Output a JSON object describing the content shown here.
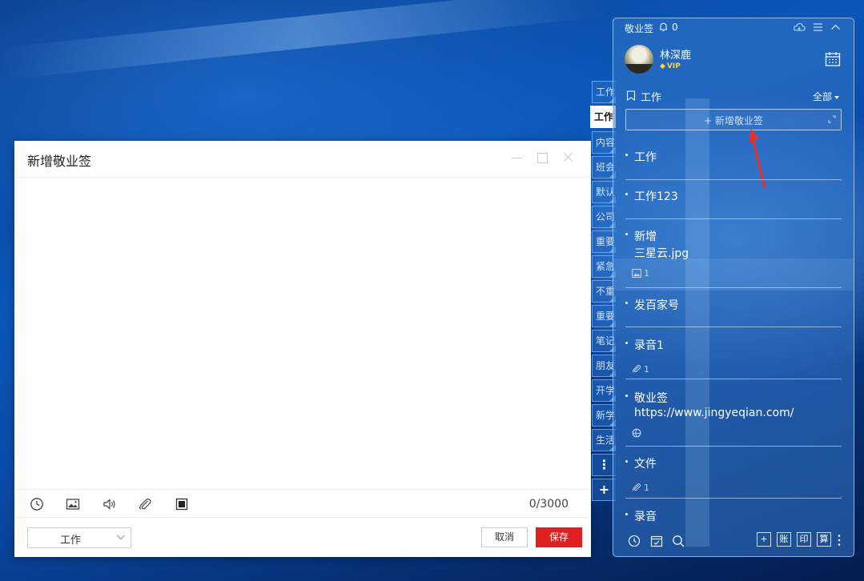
{
  "editor": {
    "title": "新增敬业签",
    "char_count": "0/3000",
    "category_value": "工作",
    "cancel_label": "取消",
    "save_label": "保存"
  },
  "side_tabs": [
    {
      "label": "工作"
    },
    {
      "label": "工作",
      "active": true
    },
    {
      "label": "内容"
    },
    {
      "label": "班会"
    },
    {
      "label": "默认"
    },
    {
      "label": "公司"
    },
    {
      "label": "重要"
    },
    {
      "label": "紧急"
    },
    {
      "label": "不重"
    },
    {
      "label": "重要"
    },
    {
      "label": "笔记"
    },
    {
      "label": "朋友"
    },
    {
      "label": "开学"
    },
    {
      "label": "新学"
    },
    {
      "label": "生活"
    }
  ],
  "side_tools": {
    "more": "⋮",
    "add": "+"
  },
  "panel": {
    "app_name": "敬业签",
    "notification_count": "0",
    "username": "林深鹿",
    "vip_label": "VIP",
    "category_title": "工作",
    "filter_label": "全部",
    "add_placeholder": "+ 新增敬业签",
    "notes": [
      {
        "title": "工作"
      },
      {
        "title": "工作123"
      },
      {
        "title": "新增",
        "line2": "三星云.jpg",
        "meta_icon": "image-icon",
        "meta_count": "1"
      },
      {
        "title": "发百家号"
      },
      {
        "title": "录音1",
        "meta_icon": "paperclip-icon",
        "meta_count": "1"
      },
      {
        "title": "敬业签",
        "line2": "https://www.jingyeqian.com/",
        "meta_icon": "browser-icon",
        "meta_count": ""
      },
      {
        "title": "文件",
        "meta_icon": "paperclip-icon",
        "meta_count": "1"
      },
      {
        "title": "录音"
      }
    ],
    "footer_boxes": [
      "+",
      "账",
      "印",
      "算"
    ]
  }
}
